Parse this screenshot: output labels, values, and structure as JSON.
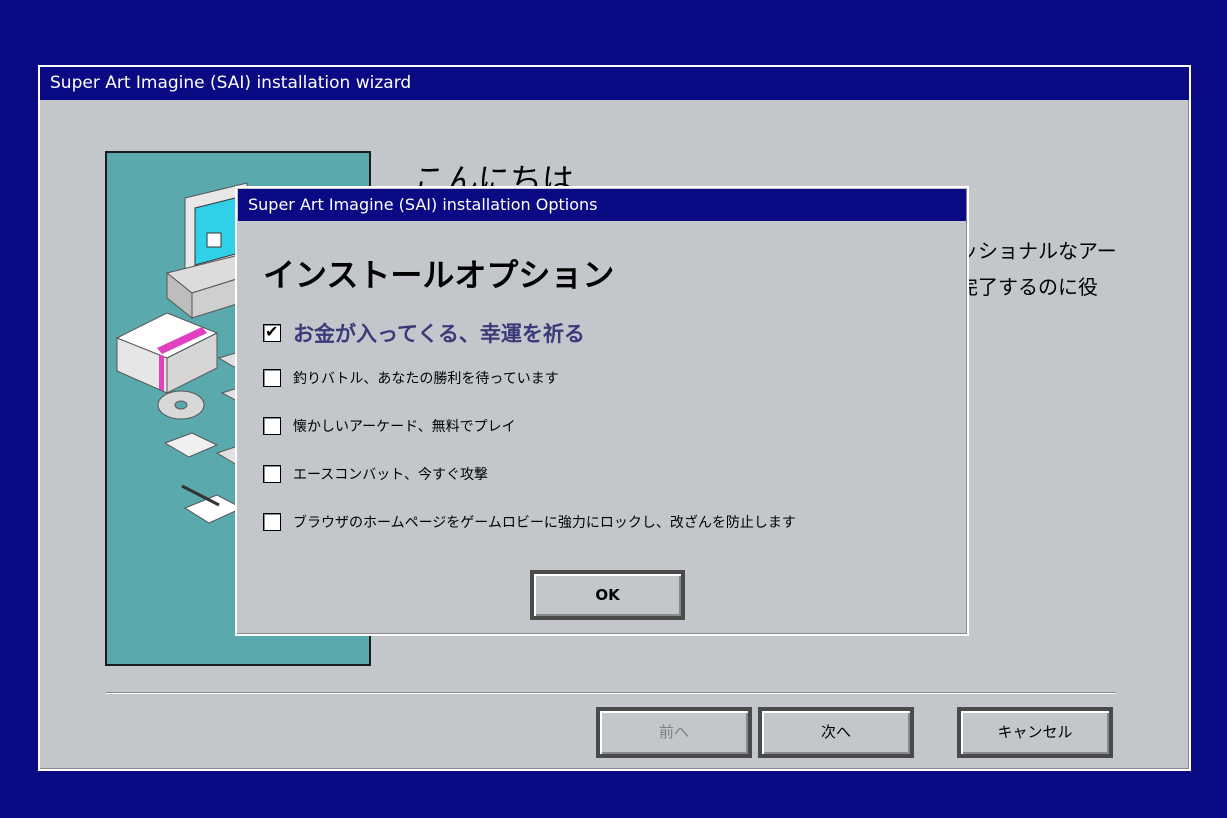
{
  "wizard": {
    "title": "Super Art Imagine (SAI) installation wizard",
    "greeting": "こんにちは",
    "body_line1": "ッショナルなアー",
    "body_line2": "完了するのに役",
    "buttons": {
      "back": "前へ",
      "next": "次へ",
      "cancel": "キャンセル"
    }
  },
  "options_dialog": {
    "title": "Super Art Imagine (SAI) installation Options",
    "heading": "インストールオプション",
    "options": [
      {
        "label": "お金が入ってくる、幸運を祈る",
        "checked": true
      },
      {
        "label": "釣りバトル、あなたの勝利を待っています",
        "checked": false
      },
      {
        "label": "懐かしいアーケード、無料でプレイ",
        "checked": false
      },
      {
        "label": "エースコンバット、今すぐ攻撃",
        "checked": false
      },
      {
        "label": "ブラウザのホームページをゲームロビーに強力にロックし、改ざんを防止します",
        "checked": false
      }
    ],
    "ok_label": "OK"
  },
  "colors": {
    "desktop": "#0a0a85",
    "titlebar": "#0a0a85",
    "window_face": "#c3c7cb",
    "art_background": "#5aa9ad"
  }
}
